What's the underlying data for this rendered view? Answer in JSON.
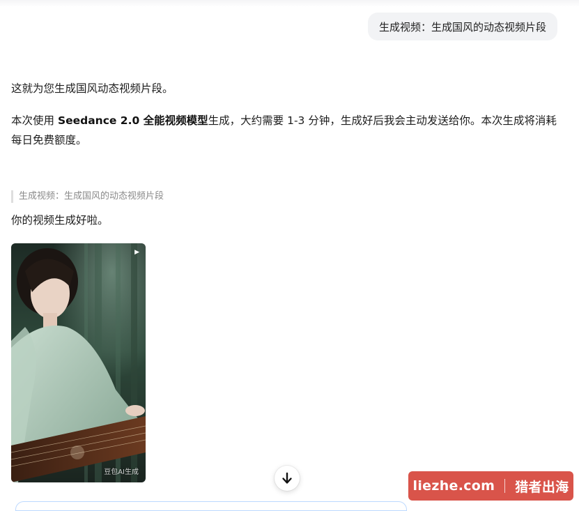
{
  "user_message": {
    "text": "生成视频：生成国风的动态视频片段"
  },
  "assistant": {
    "intro": "这就为您生成国风动态视频片段。",
    "detail_prefix": "本次使用 ",
    "detail_model": "Seedance 2.0 全能视频模型",
    "detail_suffix": "生成，大约需要 1-3 分钟，生成好后我会主动发送给你。本次生成将消耗每日免费额度。",
    "quote": "生成视频：生成国风的动态视频片段",
    "done": "你的视频生成好啦。",
    "video": {
      "watermark": "豆包AI生成",
      "play_icon": "play-icon"
    }
  },
  "scroll_button": {
    "icon": "arrow-down-icon"
  },
  "site_badge": {
    "domain": "liezhe.com",
    "name": "猎者出海",
    "color": "#d9544a"
  },
  "colors": {
    "bubble": "#f2f3f5",
    "quote_bar": "#dedede"
  }
}
